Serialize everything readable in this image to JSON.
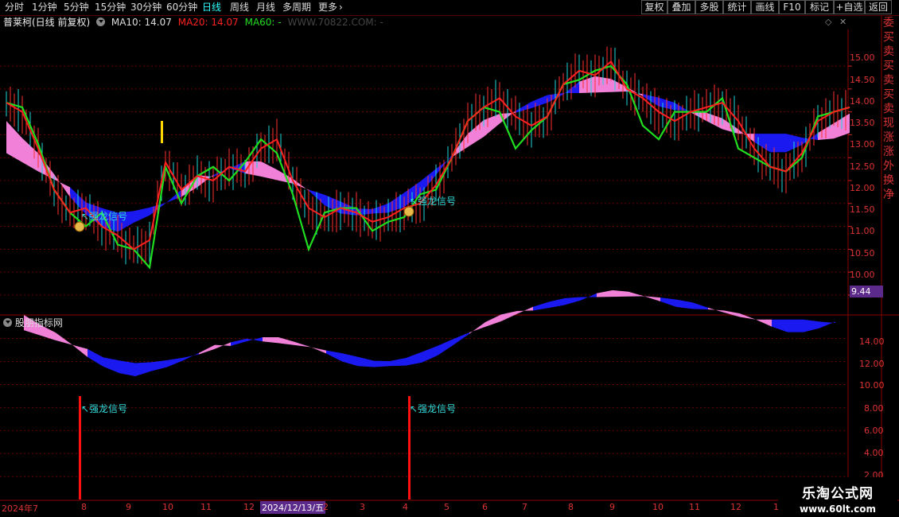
{
  "toolbar": {
    "periods": [
      "分时",
      "1分钟",
      "5分钟",
      "15分钟",
      "30分钟",
      "60分钟",
      "日线",
      "周线",
      "月线",
      "多周期",
      "更多"
    ],
    "active_period": "日线",
    "right_buttons": [
      "复权",
      "叠加",
      "多股",
      "统计",
      "画线",
      "F10",
      "标记",
      "+自选",
      "返回"
    ]
  },
  "title": {
    "stock": "普莱柯(日线 前复权)",
    "ma10": "MA10: 14.07",
    "ma20": "MA20: 14.07",
    "ma60": "MA60: -",
    "watermark": "WWW.70822.COM: -"
  },
  "price_axis": [
    "15.00",
    "14.50",
    "14.00",
    "13.50",
    "13.00",
    "12.50",
    "12.00",
    "11.50",
    "11.00",
    "10.50",
    "10.00"
  ],
  "current_price_tag": "9.44",
  "signal_label": "↖强龙信号",
  "lower_panel": {
    "title": "股朋指标网",
    "axis": [
      "14.00",
      "12.00",
      "10.00",
      "8.00",
      "6.00",
      "4.00",
      "2.00"
    ]
  },
  "x_axis": [
    "2024年7",
    "8",
    "9",
    "10",
    "11",
    "12",
    "2024/12/13/五",
    "2",
    "3",
    "4",
    "5",
    "6",
    "7",
    "8",
    "9",
    "10",
    "11",
    "12",
    "1"
  ],
  "right_panel_chars": [
    "委",
    "买",
    "卖",
    "买",
    "卖",
    "买",
    "卖",
    "现",
    "涨",
    "涨",
    "外",
    "换",
    "净"
  ],
  "brand": {
    "line1": "乐淘公式网",
    "line2": "www.60lt.com"
  },
  "chart_data": {
    "type": "line",
    "series": [
      {
        "name": "MA10",
        "color": "#ff2020",
        "x": [
          0,
          20,
          40,
          60,
          80,
          100,
          120,
          140,
          160,
          180,
          200,
          220,
          240,
          260,
          280,
          300,
          320,
          340,
          360,
          380,
          400,
          420,
          440,
          460,
          480,
          500,
          520,
          540,
          560,
          580,
          600,
          620,
          640,
          660,
          680,
          700,
          720,
          740,
          760,
          780,
          800,
          820,
          840,
          860,
          880,
          900,
          920,
          940,
          960,
          980,
          1000,
          1020,
          1040,
          1060
        ],
        "y": [
          14.2,
          14.0,
          13.2,
          12.3,
          11.8,
          11.9,
          11.5,
          11.3,
          11.0,
          11.2,
          12.9,
          12.3,
          12.6,
          12.5,
          12.8,
          12.7,
          13.2,
          13.4,
          12.5,
          11.9,
          11.7,
          11.9,
          11.8,
          11.6,
          11.7,
          11.9,
          12.0,
          12.4,
          13.0,
          13.8,
          14.1,
          14.3,
          13.9,
          13.7,
          13.9,
          14.6,
          14.9,
          14.8,
          15.1,
          14.5,
          14.3,
          14.0,
          13.8,
          14.0,
          14.1,
          14.2,
          13.8,
          13.2,
          12.8,
          12.7,
          13.1,
          13.8,
          14.0,
          14.1
        ]
      },
      {
        "name": "MA20",
        "color": "#20dd20",
        "x": [
          0,
          20,
          40,
          60,
          80,
          100,
          120,
          140,
          160,
          180,
          200,
          220,
          240,
          260,
          280,
          300,
          320,
          340,
          360,
          380,
          400,
          420,
          440,
          460,
          480,
          500,
          520,
          540,
          560,
          580,
          600,
          620,
          640,
          660,
          680,
          700,
          720,
          740,
          760,
          780,
          800,
          820,
          840,
          860,
          880,
          900,
          920,
          940,
          960,
          980,
          1000,
          1020,
          1040,
          1060
        ],
        "y": [
          14.2,
          14.1,
          13.3,
          12.3,
          11.8,
          11.5,
          11.8,
          11.1,
          11.0,
          10.6,
          12.8,
          12.0,
          12.6,
          12.8,
          12.5,
          12.9,
          13.4,
          13.1,
          12.2,
          11.0,
          11.8,
          11.9,
          11.9,
          11.4,
          11.6,
          11.7,
          12.2,
          12.3,
          13.0,
          13.8,
          14.1,
          14.0,
          13.2,
          13.6,
          13.9,
          14.6,
          14.7,
          14.9,
          15.0,
          14.6,
          13.7,
          13.4,
          14.0,
          14.0,
          14.0,
          14.3,
          13.2,
          13.0,
          12.8,
          12.7,
          13.0,
          13.9,
          14.0,
          14.1
        ]
      }
    ],
    "ylim": [
      9.6,
      15.8
    ],
    "lower_ylim": [
      0,
      15.5
    ],
    "signals_x": [
      100,
      514
    ]
  }
}
